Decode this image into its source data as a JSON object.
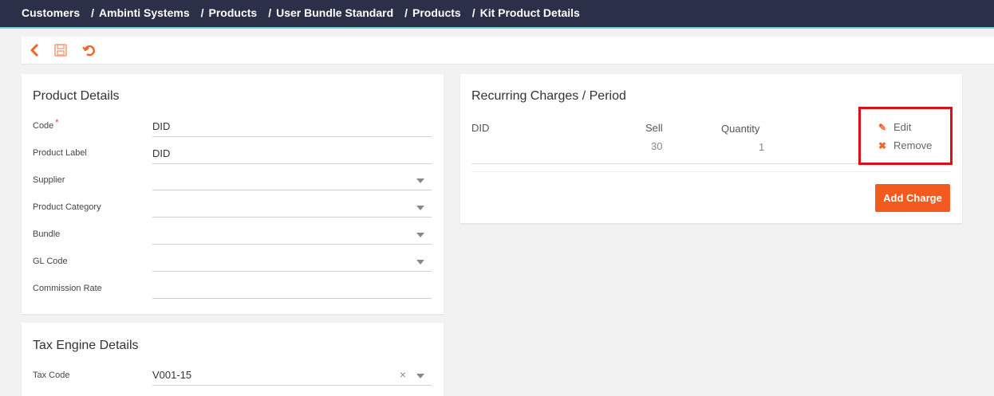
{
  "breadcrumb": [
    "Customers",
    "Ambinti Systems",
    "Products",
    "User Bundle Standard",
    "Products",
    "Kit Product Details"
  ],
  "breadcrumb_separator": "/",
  "toolbar": {
    "back_icon": "chevron-left-icon",
    "save_icon": "floppy-disk-icon",
    "undo_icon": "undo-icon"
  },
  "product_details": {
    "title": "Product Details",
    "required_marker": "*",
    "fields": [
      {
        "label": "Code",
        "value": "DID",
        "required": true,
        "type": "text"
      },
      {
        "label": "Product Label",
        "value": "DID",
        "type": "text"
      },
      {
        "label": "Supplier",
        "value": "",
        "type": "select"
      },
      {
        "label": "Product Category",
        "value": "",
        "type": "select"
      },
      {
        "label": "Bundle",
        "value": "",
        "type": "select"
      },
      {
        "label": "GL Code",
        "value": "",
        "type": "select"
      },
      {
        "label": "Commission Rate",
        "value": "",
        "type": "text"
      }
    ]
  },
  "tax_engine": {
    "title": "Tax Engine Details",
    "fields": [
      {
        "label": "Tax Code",
        "value": "V001-15",
        "type": "select",
        "clearable": true
      }
    ],
    "clear_glyph": "×"
  },
  "recurring": {
    "title": "Recurring Charges / Period",
    "columns": {
      "name": "DID",
      "sell": "Sell",
      "quantity": "Quantity"
    },
    "row": {
      "sell": "30",
      "quantity": "1"
    },
    "actions": {
      "edit": "Edit",
      "remove": "Remove",
      "edit_icon": "pencil-icon",
      "remove_icon": "close-icon"
    },
    "add_button": "Add Charge"
  },
  "colors": {
    "accent": "#f25a1f",
    "nav_bg": "#2c2f48",
    "highlight": "#d7121b"
  }
}
